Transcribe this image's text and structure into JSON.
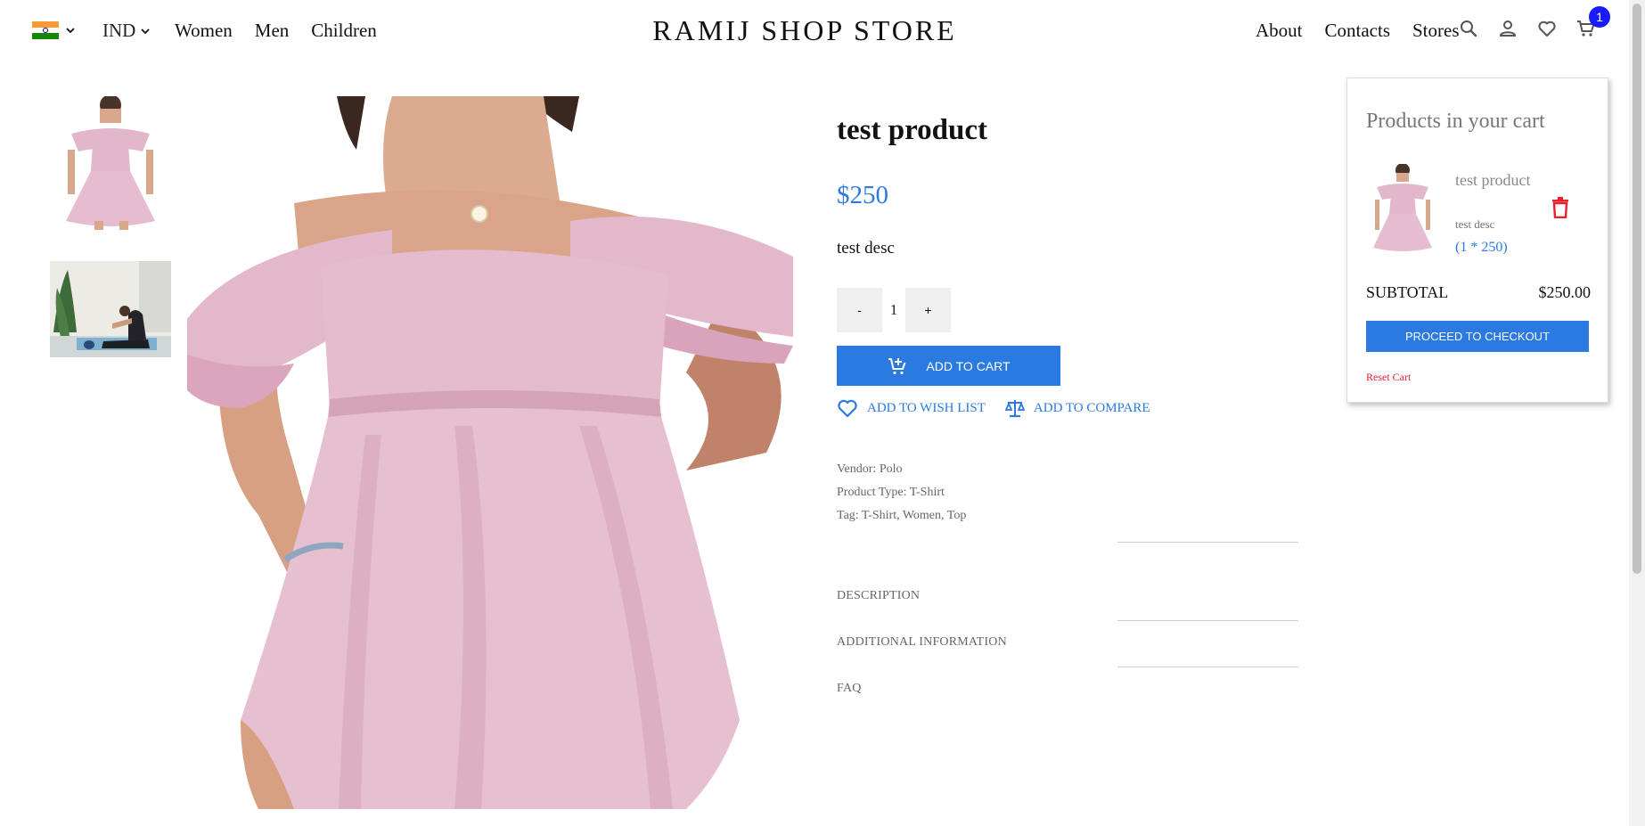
{
  "header": {
    "country_flag": "india-flag-icon",
    "currency": "IND",
    "nav_left": [
      "Women",
      "Men",
      "Children"
    ],
    "brand": "RAMIJ SHOP STORE",
    "nav_right": [
      "About",
      "Contacts",
      "Stores"
    ],
    "cart_count": "1"
  },
  "product": {
    "title": "test product",
    "price": "$250",
    "description": "test desc",
    "quantity": "1",
    "qty_minus": "-",
    "qty_plus": "+",
    "add_to_cart": "ADD TO CART",
    "add_to_wishlist": "ADD TO WISH LIST",
    "add_to_compare": "ADD TO COMPARE",
    "vendor": "Vendor: Polo",
    "product_type": "Product Type: T-Shirt",
    "tags": "Tag: T-Shirt, Women, Top",
    "tabs": [
      "DESCRIPTION",
      "ADDITIONAL INFORMATION",
      "FAQ"
    ]
  },
  "cart": {
    "title": "Products in your cart",
    "item_name": "test product",
    "item_desc": "test desc",
    "item_qty": "(1 * 250)",
    "subtotal_label": "SUBTOTAL",
    "subtotal_value": "$250.00",
    "checkout": "PROCEED TO CHECKOUT",
    "reset": "Reset Cart"
  },
  "colors": {
    "accent": "#2a7ae2",
    "badge": "#1a1aff",
    "danger": "#e8202a",
    "dress": "#e3b7cb"
  }
}
